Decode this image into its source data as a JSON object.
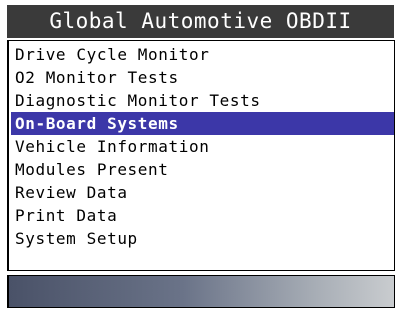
{
  "header": {
    "title": "Global Automotive OBDII"
  },
  "menu": {
    "selected_index": 3,
    "items": [
      {
        "label": "Drive Cycle Monitor"
      },
      {
        "label": "O2 Monitor Tests"
      },
      {
        "label": "Diagnostic Monitor Tests"
      },
      {
        "label": "On-Board Systems"
      },
      {
        "label": "Vehicle Information"
      },
      {
        "label": "Modules Present"
      },
      {
        "label": "Review Data"
      },
      {
        "label": "Print Data"
      },
      {
        "label": "System Setup"
      }
    ]
  },
  "colors": {
    "title_bar": "#3a3a3a",
    "selection": "#3c37a8",
    "status_gradient_start": "#4a5268",
    "status_gradient_end": "#c9cccf"
  }
}
